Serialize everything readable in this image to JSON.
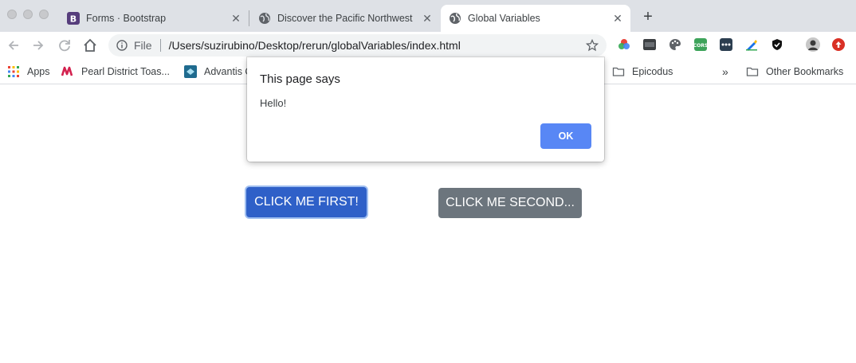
{
  "browser": {
    "tabs": [
      {
        "title": "Forms · Bootstrap",
        "favicon": "bootstrap-favicon",
        "active": false
      },
      {
        "title": "Discover the Pacific Northwest",
        "favicon": "globe-icon",
        "active": false
      },
      {
        "title": "Global Variables",
        "favicon": "globe-icon",
        "active": true
      }
    ],
    "new_tab_label": "+",
    "address": {
      "scheme_label": "File",
      "url": "/Users/suzirubino/Desktop/rerun/globalVariables/index.html"
    },
    "bookmarks": [
      {
        "label": "Apps",
        "icon": "apps-grid-icon"
      },
      {
        "label": "Pearl District Toas...",
        "icon": "pearl-district-icon"
      },
      {
        "label": "Advantis C",
        "icon": "advantis-icon"
      },
      {
        "label": "Epicodus",
        "icon": "folder-icon"
      },
      {
        "label": "Other Bookmarks",
        "icon": "folder-icon"
      }
    ],
    "bookmarks_overflow": "»"
  },
  "page": {
    "button_first": "CLICK ME FIRST!",
    "button_second": "CLICK ME SECOND..."
  },
  "dialog": {
    "title": "This page says",
    "message": "Hello!",
    "ok_label": "OK"
  },
  "colors": {
    "primary_button": "#2f60c8",
    "secondary_button": "#6c757d",
    "dialog_ok": "#5887f5"
  }
}
